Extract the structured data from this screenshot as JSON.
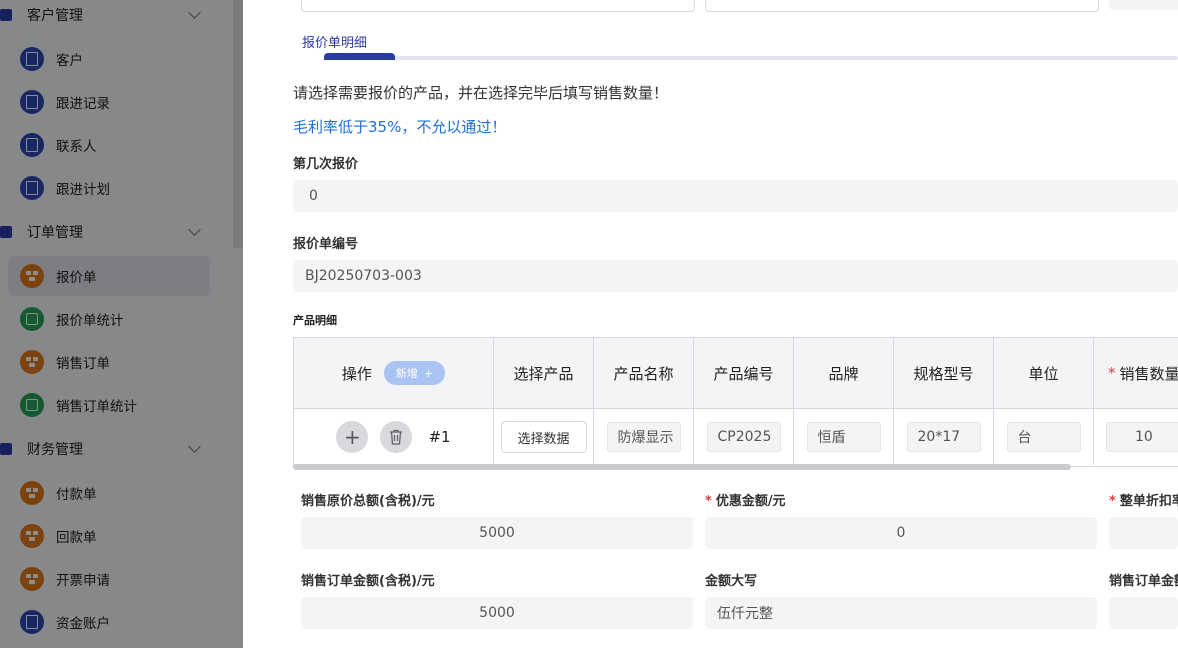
{
  "sidebar": {
    "groups": [
      {
        "label": "客户管理"
      },
      {
        "label": "订单管理"
      },
      {
        "label": "财务管理"
      }
    ],
    "customer_items": [
      {
        "label": "客户",
        "icon": "document-icon",
        "color": "blue"
      },
      {
        "label": "跟进记录",
        "icon": "document-icon",
        "color": "blue"
      },
      {
        "label": "联系人",
        "icon": "document-icon",
        "color": "blue"
      },
      {
        "label": "跟进计划",
        "icon": "document-icon",
        "color": "blue"
      }
    ],
    "order_items": [
      {
        "label": "报价单",
        "icon": "boxes-icon",
        "color": "orange",
        "active": true
      },
      {
        "label": "报价单统计",
        "icon": "chart-icon",
        "color": "green"
      },
      {
        "label": "销售订单",
        "icon": "boxes-icon",
        "color": "orange"
      },
      {
        "label": "销售订单统计",
        "icon": "chart-icon",
        "color": "green"
      }
    ],
    "finance_items": [
      {
        "label": "付款单",
        "icon": "boxes-icon",
        "color": "orange"
      },
      {
        "label": "回款单",
        "icon": "boxes-icon",
        "color": "orange"
      },
      {
        "label": "开票申请",
        "icon": "boxes-icon",
        "color": "orange"
      },
      {
        "label": "资金账户",
        "icon": "document-icon",
        "color": "blue"
      }
    ]
  },
  "drawer": {
    "tab_label": "报价单明细",
    "note_select": "请选择需要报价的产品，并在选择完毕后填写销售数量！",
    "note_margin": "毛利率低于35%，不允以通过！",
    "quote_round": {
      "label": "第几次报价",
      "value": "0"
    },
    "quote_number": {
      "label": "报价单编号",
      "value": "BJ20250703-003"
    },
    "product_section_label": "产品明细",
    "table": {
      "headers": [
        "操作",
        "选择产品",
        "产品名称",
        "产品编号",
        "品牌",
        "规格型号",
        "单位",
        "销售数量"
      ],
      "add_label": "新增",
      "required_headers": [
        "销售数量"
      ],
      "row": {
        "number": "#1",
        "select_label": "选择数据",
        "product_name": "防爆显示",
        "product_code": "CP2025",
        "brand": "恒盾",
        "spec": "20*17",
        "unit": "台",
        "quantity": "10"
      }
    },
    "totals": {
      "original_total": {
        "label": "销售原价总额(含税)/元",
        "value": "5000"
      },
      "discount": {
        "label": "优惠金额/元",
        "value": "0",
        "required": true
      },
      "whole_discount": {
        "label": "整单折扣率",
        "required": true
      },
      "order_amount": {
        "label": "销售订单金额(含税)/元",
        "value": "5000"
      },
      "amount_words": {
        "label": "金额大写",
        "value": "伍仟元整"
      },
      "order_amount_2": {
        "label": "销售订单金额"
      }
    }
  }
}
